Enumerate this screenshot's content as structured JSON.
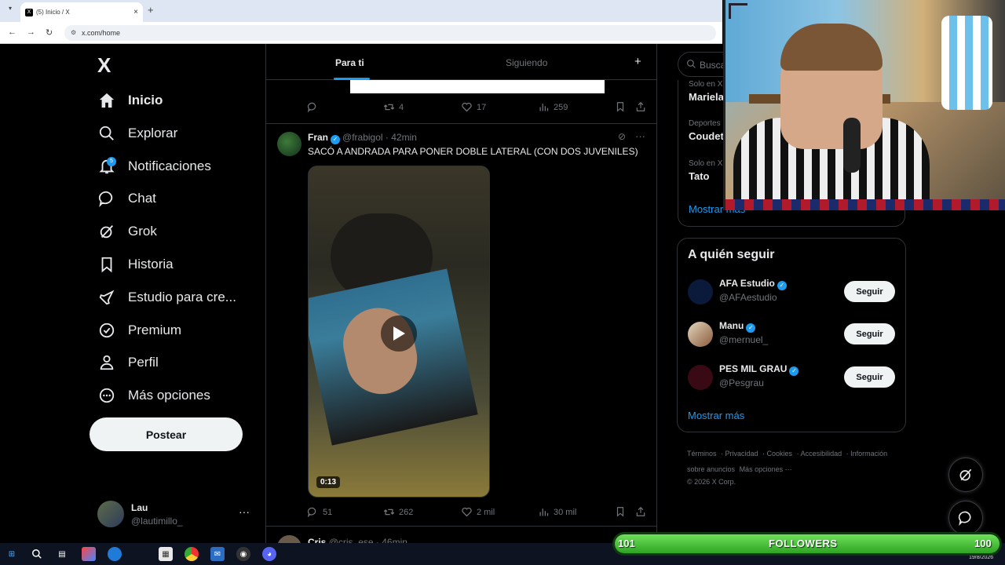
{
  "browser": {
    "tab_title": "(5) Inicio / X",
    "tab_close": "×",
    "new_tab": "+",
    "url": "x.com/home"
  },
  "nav": {
    "logo": "X",
    "items": [
      {
        "label": "Inicio",
        "icon": "home-icon"
      },
      {
        "label": "Explorar",
        "icon": "search-icon"
      },
      {
        "label": "Notificaciones",
        "icon": "bell-icon",
        "badge": "5"
      },
      {
        "label": "Chat",
        "icon": "chat-icon"
      },
      {
        "label": "Grok",
        "icon": "grok-icon"
      },
      {
        "label": "Historia",
        "icon": "bookmark-icon"
      },
      {
        "label": "Estudio para cre...",
        "icon": "rocket-icon"
      },
      {
        "label": "Premium",
        "icon": "premium-icon"
      },
      {
        "label": "Perfil",
        "icon": "person-icon"
      },
      {
        "label": "Más opciones",
        "icon": "more-circle-icon"
      }
    ],
    "post_button": "Postear",
    "account": {
      "name": "Lau",
      "handle": "@lautimillo_",
      "more": "···"
    }
  },
  "timeline": {
    "tabs": {
      "for_you": "Para ti",
      "following": "Siguiendo",
      "plus": "+"
    },
    "prev_actions": {
      "replies": "",
      "retweets": "4",
      "likes": "17",
      "views": "259"
    },
    "tweet": {
      "name": "Fran",
      "handle": "@frabigol",
      "time": "42min",
      "text": "SACÓ A ANDRADA PARA PONER DOBLE LATERAL (CON DOS JUVENILES)",
      "video_duration": "0:13",
      "more": "···",
      "actions": {
        "replies": "51",
        "retweets": "262",
        "likes": "2 mil",
        "views": "30 mil"
      }
    },
    "next_tweet": {
      "name": "Cris",
      "handle": "@cris_ese",
      "time": "46min"
    }
  },
  "sidebar": {
    "search_placeholder": "Busca",
    "trends": [
      {
        "context": "Solo en X",
        "title": "Mariela"
      },
      {
        "context": "Deportes",
        "title": "Coudet"
      },
      {
        "context": "Solo en X",
        "title": "Tato"
      }
    ],
    "trends_show_more": "Mostrar más",
    "who_to_follow": {
      "title": "A quién seguir",
      "items": [
        {
          "name": "AFA Estudio",
          "handle": "@AFAestudio",
          "button": "Seguir"
        },
        {
          "name": "Manu",
          "handle": "@mernuel_",
          "button": "Seguir"
        },
        {
          "name": "PES MIL GRAU",
          "handle": "@Pesgrau",
          "button": "Seguir"
        }
      ],
      "show_more": "Mostrar más"
    },
    "footer": {
      "links": [
        "Términos",
        "Privacidad",
        "Cookies",
        "Accesibilidad",
        "Información sobre anuncios",
        "Más opciones ···"
      ],
      "copyright": "© 2026 X Corp."
    }
  },
  "overlay": {
    "followers_current": "101",
    "followers_label": "FOLLOWERS",
    "followers_goal": "100"
  },
  "taskbar": {
    "date": "19/8/2026"
  },
  "colors": {
    "accent": "#1d9bf0",
    "bg": "#000000",
    "text": "#e7e9ea",
    "muted": "#71767b"
  }
}
